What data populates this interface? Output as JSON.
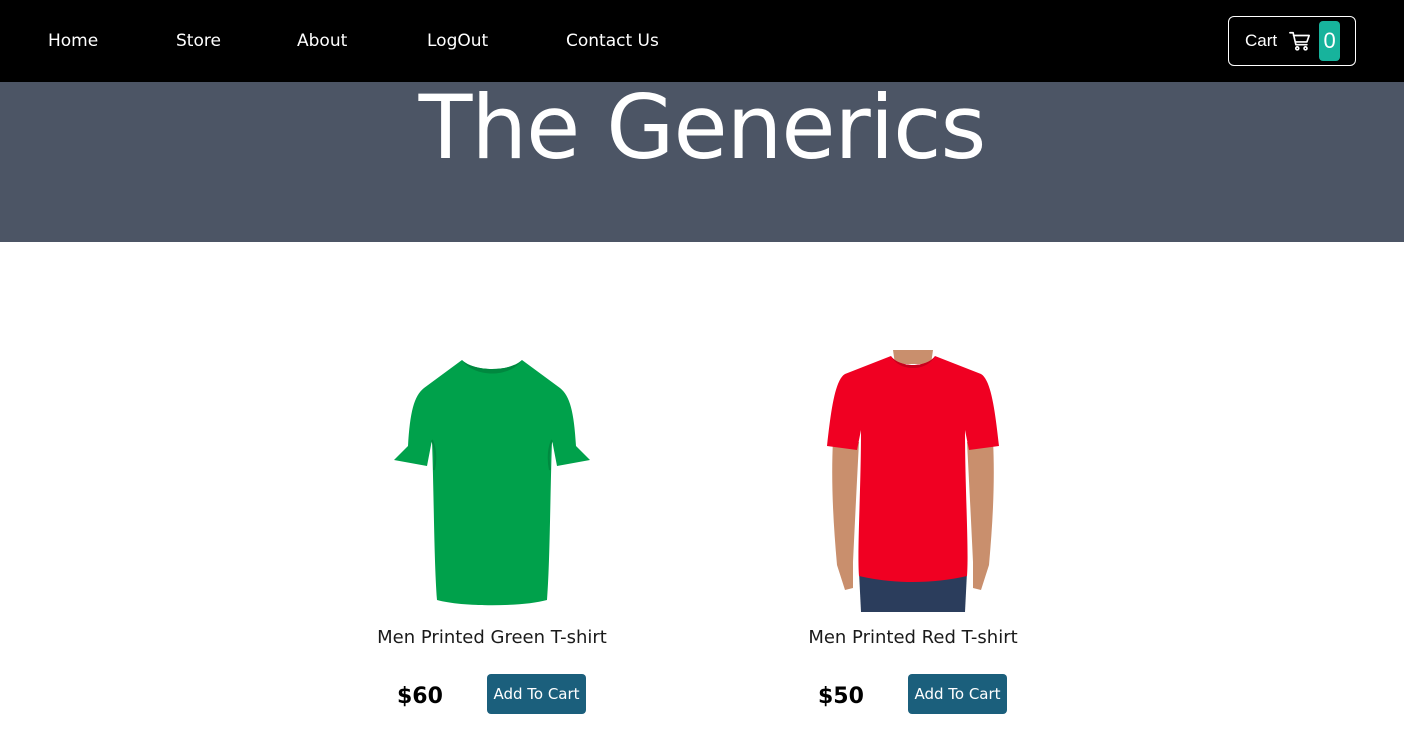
{
  "nav": {
    "links": [
      {
        "label": "Home"
      },
      {
        "label": "Store"
      },
      {
        "label": "About"
      },
      {
        "label": "LogOut"
      },
      {
        "label": "Contact Us"
      }
    ],
    "cart": {
      "label": "Cart",
      "count": "0",
      "icon": "cart-icon",
      "badge_color": "#17b39c"
    }
  },
  "hero": {
    "title": "The Generics",
    "bg_color": "#4c5565"
  },
  "products": [
    {
      "title": "Men Printed Green T-shirt",
      "price": "$60",
      "button": "Add To Cart",
      "image": "green-tshirt",
      "color": "#00a14b"
    },
    {
      "title": "Men Printed Red T-shirt",
      "price": "$50",
      "button": "Add To Cart",
      "image": "red-tshirt-model",
      "color": "#f00022"
    }
  ],
  "theme": {
    "button_color": "#1b5f7c",
    "nav_bg": "#000000"
  }
}
